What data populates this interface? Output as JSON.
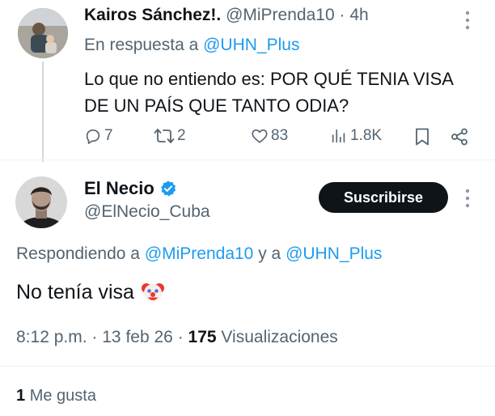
{
  "reply_tweet": {
    "name": "Kairos Sánchez!.",
    "handle": "@MiPrenda10",
    "separator": "·",
    "time": "4h",
    "replying_prefix": "En respuesta a",
    "replying_to": "@UHN_Plus",
    "text_line1": "Lo que no entiendo es: POR QUÉ TENIA VISA",
    "text_line2": "DE UN PAÍS QUE TANTO ODIA?",
    "actions": {
      "replies": "7",
      "retweets": "2",
      "likes": "83",
      "views": "1.8K"
    }
  },
  "main_tweet": {
    "name": "El Necio",
    "handle": "@ElNecio_Cuba",
    "subscribe_label": "Suscribirse",
    "replying_prefix": "Respondiendo a",
    "replying_user1": "@MiPrenda10",
    "replying_joiner": "y a",
    "replying_user2": "@UHN_Plus",
    "text": "No tenía visa",
    "emoji": "🤡",
    "meta": {
      "time": "8:12 p.m.",
      "sep1": "·",
      "date": "13 feb 26",
      "sep2": "·",
      "views_count": "175",
      "views_label": "Visualizaciones"
    },
    "likes_count": "1",
    "likes_label": "Me gusta"
  },
  "colors": {
    "accent": "#1d9bf0",
    "text": "#0f1419",
    "muted": "#536471",
    "divider": "#eff3f4"
  }
}
